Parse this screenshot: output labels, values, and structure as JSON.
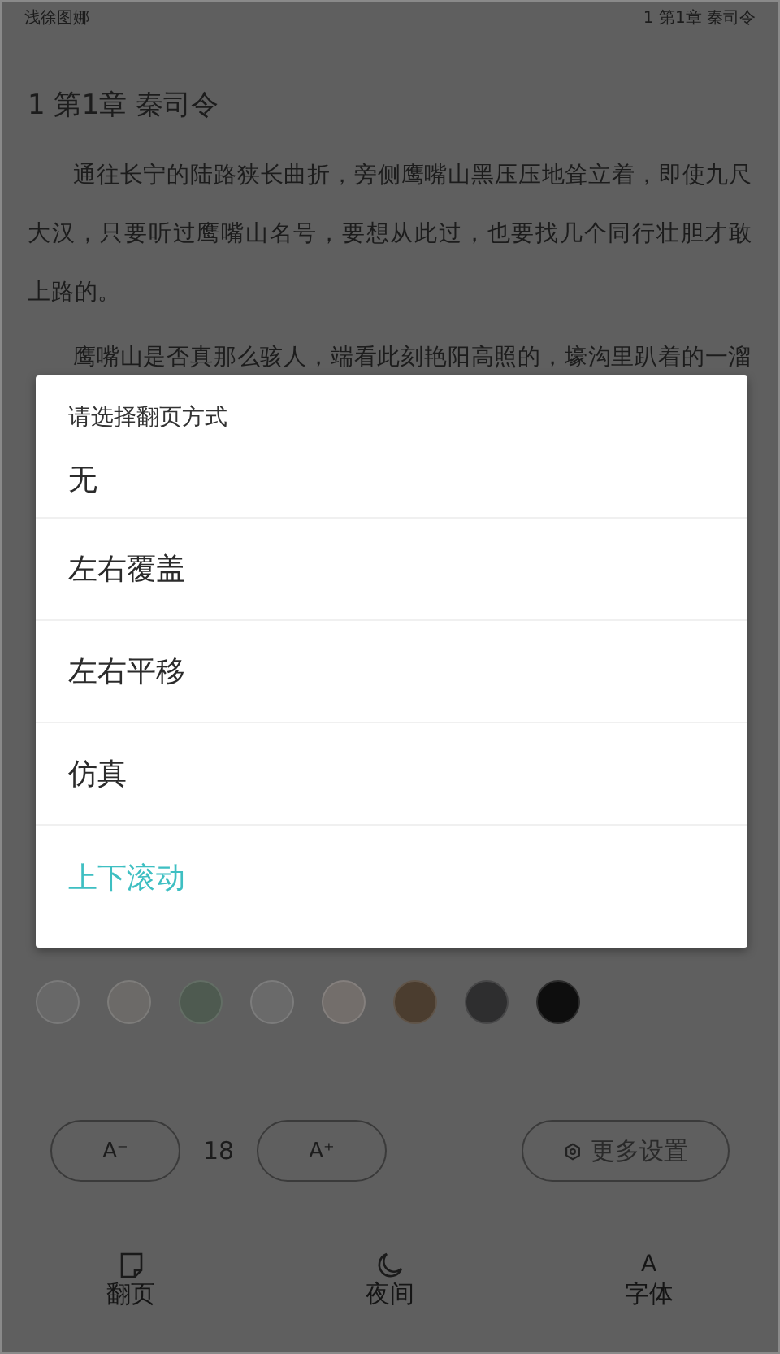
{
  "status_bar": {
    "book_title": "浅徐图娜",
    "chapter": "1 第1章 秦司令"
  },
  "chapter_title": "1 第1章 秦司令",
  "paragraphs": [
    "通往长宁的陆路狭长曲折，旁侧鹰嘴山黑压压地耸立着，即使九尺大汉，只要听过鹰嘴山名号，要想从此过，也要找几个同行壮胆才敢上路的。",
    "鹰嘴山是否真那么骇人，端看此刻艳阳高照的，壕沟里趴着的一溜"
  ],
  "dialog": {
    "title": "请选择翻页方式",
    "options": [
      {
        "label": "无",
        "selected": false
      },
      {
        "label": "左右覆盖",
        "selected": false
      },
      {
        "label": "左右平移",
        "selected": false
      },
      {
        "label": "仿真",
        "selected": false
      },
      {
        "label": "上下滚动",
        "selected": true
      }
    ]
  },
  "background_swatches": [
    {
      "color": "#686868"
    },
    {
      "color": "#6c6a68"
    },
    {
      "color": "#4e5a50"
    },
    {
      "color": "#6a6a6a"
    },
    {
      "color": "#736e6b"
    },
    {
      "color": "#4b3d2f"
    },
    {
      "color": "#2e2e2f"
    },
    {
      "color": "#0e0e0e"
    }
  ],
  "font_size": {
    "decrease": "A⁻",
    "value": "18",
    "increase": "A⁺"
  },
  "more_settings": "更多设置",
  "bottom_nav": [
    {
      "kind": "page",
      "label": "翻页"
    },
    {
      "kind": "night",
      "label": "夜间"
    },
    {
      "kind": "font",
      "label": "字体",
      "glyph": "A"
    }
  ]
}
